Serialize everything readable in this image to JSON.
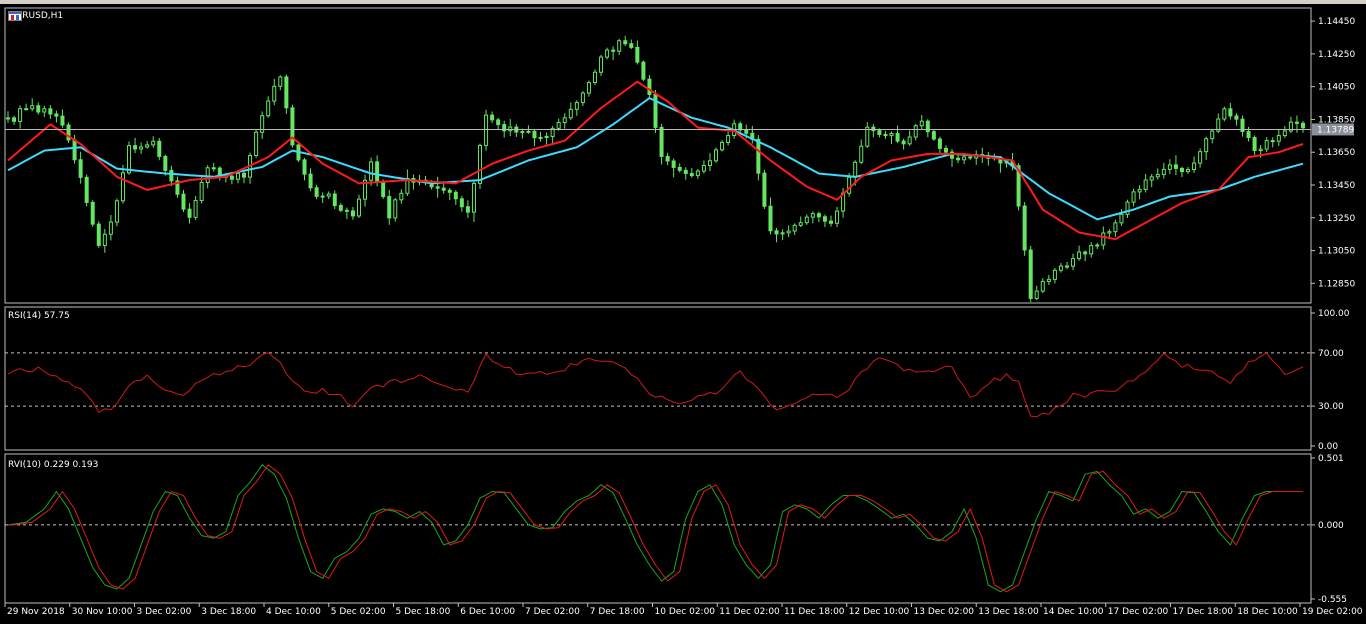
{
  "window": {
    "symbol_label": "EURUSD,H1",
    "icons": [
      "chart-window-icon",
      "chart-window-icon-2"
    ]
  },
  "colors": {
    "background": "#000000",
    "frame": "#c0c0c0",
    "candles": "#64e662",
    "ma_fast": "#ff1a1a",
    "ma_slow": "#3bdcff",
    "rsi_line": "#d01818",
    "rvi_main": "#18a818",
    "rvi_signal": "#e01a1a",
    "price_tag_bg": "#8a9099"
  },
  "chart_data": [
    {
      "type": "candlestick",
      "title": "EURUSD,H1",
      "ylim": [
        1.1273,
        1.1453
      ],
      "yticks": [
        "1.14450",
        "1.14250",
        "1.14050",
        "1.13850",
        "1.13650",
        "1.13450",
        "1.13250",
        "1.13050",
        "1.12850"
      ],
      "current_price": "1.13789",
      "price_anchors": [
        [
          0,
          1.1385
        ],
        [
          3,
          1.1392
        ],
        [
          6,
          1.1392
        ],
        [
          9,
          1.1382
        ],
        [
          12,
          1.1348
        ],
        [
          15,
          1.1308
        ],
        [
          17,
          1.1322
        ],
        [
          20,
          1.1368
        ],
        [
          24,
          1.1372
        ],
        [
          27,
          1.1345
        ],
        [
          30,
          1.1325
        ],
        [
          33,
          1.1358
        ],
        [
          36,
          1.1348
        ],
        [
          39,
          1.1352
        ],
        [
          42,
          1.1388
        ],
        [
          45,
          1.1412
        ],
        [
          47,
          1.1368
        ],
        [
          50,
          1.1342
        ],
        [
          53,
          1.1338
        ],
        [
          57,
          1.1326
        ],
        [
          60,
          1.1358
        ],
        [
          63,
          1.1326
        ],
        [
          66,
          1.1348
        ],
        [
          70,
          1.1345
        ],
        [
          73,
          1.134
        ],
        [
          76,
          1.1328
        ],
        [
          79,
          1.1388
        ],
        [
          82,
          1.138
        ],
        [
          86,
          1.1376
        ],
        [
          89,
          1.1376
        ],
        [
          92,
          1.1386
        ],
        [
          95,
          1.1402
        ],
        [
          99,
          1.1428
        ],
        [
          102,
          1.1432
        ],
        [
          104,
          1.142
        ],
        [
          106,
          1.14
        ],
        [
          108,
          1.1362
        ],
        [
          111,
          1.1352
        ],
        [
          114,
          1.1352
        ],
        [
          117,
          1.1366
        ],
        [
          120,
          1.1382
        ],
        [
          123,
          1.1372
        ],
        [
          126,
          1.1315
        ],
        [
          129,
          1.1318
        ],
        [
          133,
          1.1328
        ],
        [
          136,
          1.1322
        ],
        [
          139,
          1.1348
        ],
        [
          142,
          1.1378
        ],
        [
          145,
          1.1375
        ],
        [
          148,
          1.1372
        ],
        [
          151,
          1.1385
        ],
        [
          154,
          1.1368
        ],
        [
          157,
          1.1362
        ],
        [
          160,
          1.1362
        ],
        [
          163,
          1.136
        ],
        [
          166,
          1.1358
        ],
        [
          169,
          1.1278
        ],
        [
          171,
          1.1285
        ],
        [
          174,
          1.1295
        ],
        [
          177,
          1.1302
        ],
        [
          180,
          1.131
        ],
        [
          183,
          1.132
        ],
        [
          186,
          1.134
        ],
        [
          189,
          1.135
        ],
        [
          192,
          1.1356
        ],
        [
          195,
          1.1352
        ],
        [
          198,
          1.137
        ],
        [
          201,
          1.1392
        ],
        [
          203,
          1.1385
        ],
        [
          206,
          1.1365
        ],
        [
          209,
          1.1372
        ],
        [
          212,
          1.1382
        ],
        [
          214,
          1.138
        ]
      ],
      "ma_fast_anchors": [
        [
          0,
          1.136
        ],
        [
          7,
          1.1382
        ],
        [
          12,
          1.137
        ],
        [
          18,
          1.135
        ],
        [
          23,
          1.1342
        ],
        [
          30,
          1.1348
        ],
        [
          36,
          1.135
        ],
        [
          43,
          1.1362
        ],
        [
          47,
          1.1374
        ],
        [
          52,
          1.1358
        ],
        [
          58,
          1.1346
        ],
        [
          66,
          1.1348
        ],
        [
          74,
          1.1346
        ],
        [
          80,
          1.1358
        ],
        [
          86,
          1.1366
        ],
        [
          92,
          1.1372
        ],
        [
          98,
          1.1392
        ],
        [
          104,
          1.1408
        ],
        [
          109,
          1.1396
        ],
        [
          114,
          1.138
        ],
        [
          120,
          1.1378
        ],
        [
          126,
          1.136
        ],
        [
          132,
          1.1344
        ],
        [
          137,
          1.1336
        ],
        [
          141,
          1.135
        ],
        [
          146,
          1.136
        ],
        [
          152,
          1.1364
        ],
        [
          158,
          1.1364
        ],
        [
          166,
          1.136
        ],
        [
          171,
          1.133
        ],
        [
          177,
          1.1316
        ],
        [
          183,
          1.1312
        ],
        [
          188,
          1.1322
        ],
        [
          194,
          1.1334
        ],
        [
          200,
          1.1342
        ],
        [
          205,
          1.1362
        ],
        [
          210,
          1.1365
        ],
        [
          214,
          1.137
        ]
      ],
      "ma_slow_anchors": [
        [
          0,
          1.1354
        ],
        [
          6,
          1.1366
        ],
        [
          12,
          1.1368
        ],
        [
          18,
          1.1355
        ],
        [
          26,
          1.1352
        ],
        [
          34,
          1.135
        ],
        [
          42,
          1.1356
        ],
        [
          47,
          1.1366
        ],
        [
          52,
          1.1362
        ],
        [
          60,
          1.1352
        ],
        [
          70,
          1.1346
        ],
        [
          78,
          1.1348
        ],
        [
          86,
          1.136
        ],
        [
          94,
          1.1368
        ],
        [
          100,
          1.1382
        ],
        [
          106,
          1.1398
        ],
        [
          113,
          1.1386
        ],
        [
          119,
          1.138
        ],
        [
          126,
          1.1368
        ],
        [
          134,
          1.1352
        ],
        [
          140,
          1.135
        ],
        [
          148,
          1.1356
        ],
        [
          156,
          1.1364
        ],
        [
          164,
          1.1362
        ],
        [
          172,
          1.134
        ],
        [
          180,
          1.1324
        ],
        [
          186,
          1.133
        ],
        [
          192,
          1.1338
        ],
        [
          200,
          1.1342
        ],
        [
          206,
          1.135
        ],
        [
          214,
          1.1358
        ]
      ]
    },
    {
      "type": "line",
      "title": "RSI(14) 57.75",
      "ylim": [
        0,
        100
      ],
      "yticks": [
        "100.00",
        "70.00",
        "30.00",
        "0.00"
      ],
      "levels": [
        70,
        30
      ],
      "anchors": [
        [
          0,
          55
        ],
        [
          4,
          58
        ],
        [
          8,
          52
        ],
        [
          12,
          44
        ],
        [
          15,
          25
        ],
        [
          17,
          30
        ],
        [
          20,
          45
        ],
        [
          23,
          52
        ],
        [
          26,
          42
        ],
        [
          29,
          38
        ],
        [
          32,
          52
        ],
        [
          36,
          55
        ],
        [
          40,
          63
        ],
        [
          43,
          70
        ],
        [
          46,
          55
        ],
        [
          49,
          40
        ],
        [
          52,
          42
        ],
        [
          55,
          38
        ],
        [
          57,
          30
        ],
        [
          60,
          45
        ],
        [
          64,
          48
        ],
        [
          67,
          52
        ],
        [
          70,
          50
        ],
        [
          73,
          42
        ],
        [
          76,
          40
        ],
        [
          79,
          68
        ],
        [
          82,
          58
        ],
        [
          86,
          54
        ],
        [
          90,
          55
        ],
        [
          94,
          62
        ],
        [
          98,
          66
        ],
        [
          102,
          60
        ],
        [
          106,
          40
        ],
        [
          110,
          32
        ],
        [
          114,
          36
        ],
        [
          118,
          42
        ],
        [
          121,
          58
        ],
        [
          124,
          40
        ],
        [
          127,
          27
        ],
        [
          131,
          35
        ],
        [
          135,
          40
        ],
        [
          138,
          38
        ],
        [
          141,
          56
        ],
        [
          144,
          66
        ],
        [
          148,
          58
        ],
        [
          152,
          56
        ],
        [
          156,
          60
        ],
        [
          159,
          35
        ],
        [
          162,
          48
        ],
        [
          165,
          52
        ],
        [
          167,
          48
        ],
        [
          169,
          22
        ],
        [
          172,
          24
        ],
        [
          176,
          38
        ],
        [
          180,
          40
        ],
        [
          184,
          45
        ],
        [
          188,
          55
        ],
        [
          191,
          70
        ],
        [
          194,
          60
        ],
        [
          198,
          58
        ],
        [
          202,
          48
        ],
        [
          205,
          62
        ],
        [
          208,
          70
        ],
        [
          211,
          52
        ],
        [
          214,
          58
        ]
      ]
    },
    {
      "type": "line",
      "title": "RVI(10) 0.229 0.193",
      "ylim": [
        -0.555,
        0.501
      ],
      "yticks": [
        "0.501",
        "0.000",
        "-0.555"
      ],
      "levels": [
        0
      ],
      "main_anchors": [
        [
          0,
          0.0
        ],
        [
          3,
          0.02
        ],
        [
          6,
          0.12
        ],
        [
          8,
          0.25
        ],
        [
          10,
          0.12
        ],
        [
          12,
          -0.1
        ],
        [
          14,
          -0.32
        ],
        [
          16,
          -0.45
        ],
        [
          18,
          -0.48
        ],
        [
          20,
          -0.4
        ],
        [
          22,
          -0.15
        ],
        [
          24,
          0.1
        ],
        [
          26,
          0.25
        ],
        [
          28,
          0.22
        ],
        [
          30,
          0.05
        ],
        [
          32,
          -0.08
        ],
        [
          34,
          -0.1
        ],
        [
          36,
          -0.05
        ],
        [
          38,
          0.22
        ],
        [
          40,
          0.32
        ],
        [
          42,
          0.45
        ],
        [
          44,
          0.38
        ],
        [
          46,
          0.2
        ],
        [
          48,
          -0.1
        ],
        [
          50,
          -0.35
        ],
        [
          52,
          -0.4
        ],
        [
          54,
          -0.25
        ],
        [
          56,
          -0.2
        ],
        [
          58,
          -0.1
        ],
        [
          60,
          0.08
        ],
        [
          62,
          0.12
        ],
        [
          64,
          0.1
        ],
        [
          66,
          0.05
        ],
        [
          68,
          0.1
        ],
        [
          70,
          0.02
        ],
        [
          72,
          -0.15
        ],
        [
          74,
          -0.12
        ],
        [
          76,
          0.0
        ],
        [
          78,
          0.2
        ],
        [
          80,
          0.25
        ],
        [
          82,
          0.24
        ],
        [
          84,
          0.12
        ],
        [
          86,
          0.0
        ],
        [
          88,
          -0.03
        ],
        [
          90,
          -0.02
        ],
        [
          92,
          0.1
        ],
        [
          94,
          0.18
        ],
        [
          96,
          0.22
        ],
        [
          98,
          0.3
        ],
        [
          100,
          0.24
        ],
        [
          102,
          0.05
        ],
        [
          104,
          -0.15
        ],
        [
          106,
          -0.3
        ],
        [
          108,
          -0.42
        ],
        [
          110,
          -0.35
        ],
        [
          112,
          0.05
        ],
        [
          114,
          0.25
        ],
        [
          116,
          0.3
        ],
        [
          118,
          0.15
        ],
        [
          120,
          -0.15
        ],
        [
          122,
          -0.3
        ],
        [
          124,
          -0.4
        ],
        [
          126,
          -0.3
        ],
        [
          128,
          0.1
        ],
        [
          130,
          0.15
        ],
        [
          132,
          0.12
        ],
        [
          134,
          0.05
        ],
        [
          136,
          0.15
        ],
        [
          138,
          0.22
        ],
        [
          140,
          0.22
        ],
        [
          142,
          0.18
        ],
        [
          144,
          0.12
        ],
        [
          146,
          0.05
        ],
        [
          148,
          0.08
        ],
        [
          150,
          0.0
        ],
        [
          152,
          -0.1
        ],
        [
          154,
          -0.12
        ],
        [
          156,
          -0.05
        ],
        [
          158,
          0.12
        ],
        [
          160,
          -0.1
        ],
        [
          162,
          -0.45
        ],
        [
          164,
          -0.5
        ],
        [
          166,
          -0.45
        ],
        [
          168,
          -0.2
        ],
        [
          170,
          0.05
        ],
        [
          172,
          0.25
        ],
        [
          174,
          0.22
        ],
        [
          176,
          0.18
        ],
        [
          178,
          0.38
        ],
        [
          180,
          0.4
        ],
        [
          182,
          0.3
        ],
        [
          184,
          0.22
        ],
        [
          186,
          0.08
        ],
        [
          188,
          0.12
        ],
        [
          190,
          0.05
        ],
        [
          192,
          0.1
        ],
        [
          194,
          0.25
        ],
        [
          196,
          0.24
        ],
        [
          198,
          0.1
        ],
        [
          200,
          -0.05
        ],
        [
          202,
          -0.15
        ],
        [
          204,
          0.05
        ],
        [
          206,
          0.22
        ],
        [
          208,
          0.25
        ]
      ],
      "signal_lag_bars": 1
    }
  ],
  "x_axis": {
    "labels": [
      "29 Nov 2018",
      "30 Nov 10:00",
      "3 Dec 02:00",
      "3 Dec 18:00",
      "4 Dec 10:00",
      "5 Dec 02:00",
      "5 Dec 18:00",
      "6 Dec 10:00",
      "7 Dec 02:00",
      "7 Dec 18:00",
      "10 Dec 02:00",
      "11 Dec 02:00",
      "11 Dec 18:00",
      "12 Dec 10:00",
      "13 Dec 02:00",
      "13 Dec 18:00",
      "14 Dec 10:00",
      "17 Dec 02:00",
      "17 Dec 18:00",
      "18 Dec 10:00",
      "19 Dec 02:00"
    ]
  }
}
